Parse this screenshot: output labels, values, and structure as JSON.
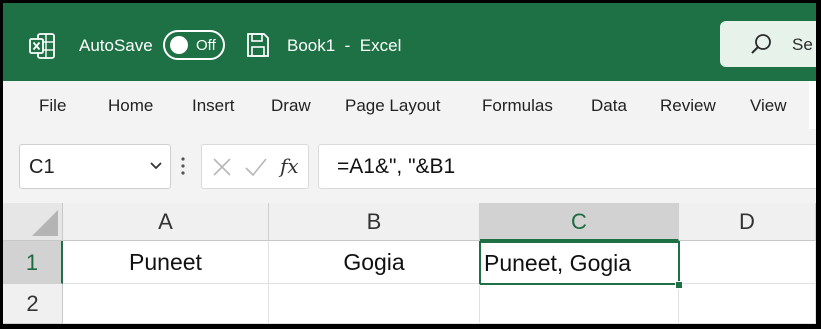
{
  "titlebar": {
    "app_icon": "excel-icon",
    "autosave_label": "AutoSave",
    "autosave_state": "Off",
    "save_icon": "save-icon",
    "doc_name": "Book1",
    "separator": "-",
    "app_name": "Excel",
    "search_placeholder": "Se",
    "search_icon": "search-icon"
  },
  "menu": {
    "items": [
      "File",
      "Home",
      "Insert",
      "Draw",
      "Page Layout",
      "Formulas",
      "Data",
      "Review",
      "View"
    ]
  },
  "formula_bar": {
    "name_box": "C1",
    "fx_label": "fx",
    "formula": "=A1&\", \"&B1"
  },
  "grid": {
    "columns": [
      "A",
      "B",
      "C",
      "D"
    ],
    "rows": [
      "1",
      "2"
    ],
    "cells": {
      "A1": "Puneet",
      "B1": "Gogia",
      "C1": "Puneet, Gogia"
    },
    "active_cell": "C1"
  },
  "colors": {
    "title_bar": "#1e7145",
    "accent": "#1e7145",
    "search_box": "#e6f2ea"
  }
}
